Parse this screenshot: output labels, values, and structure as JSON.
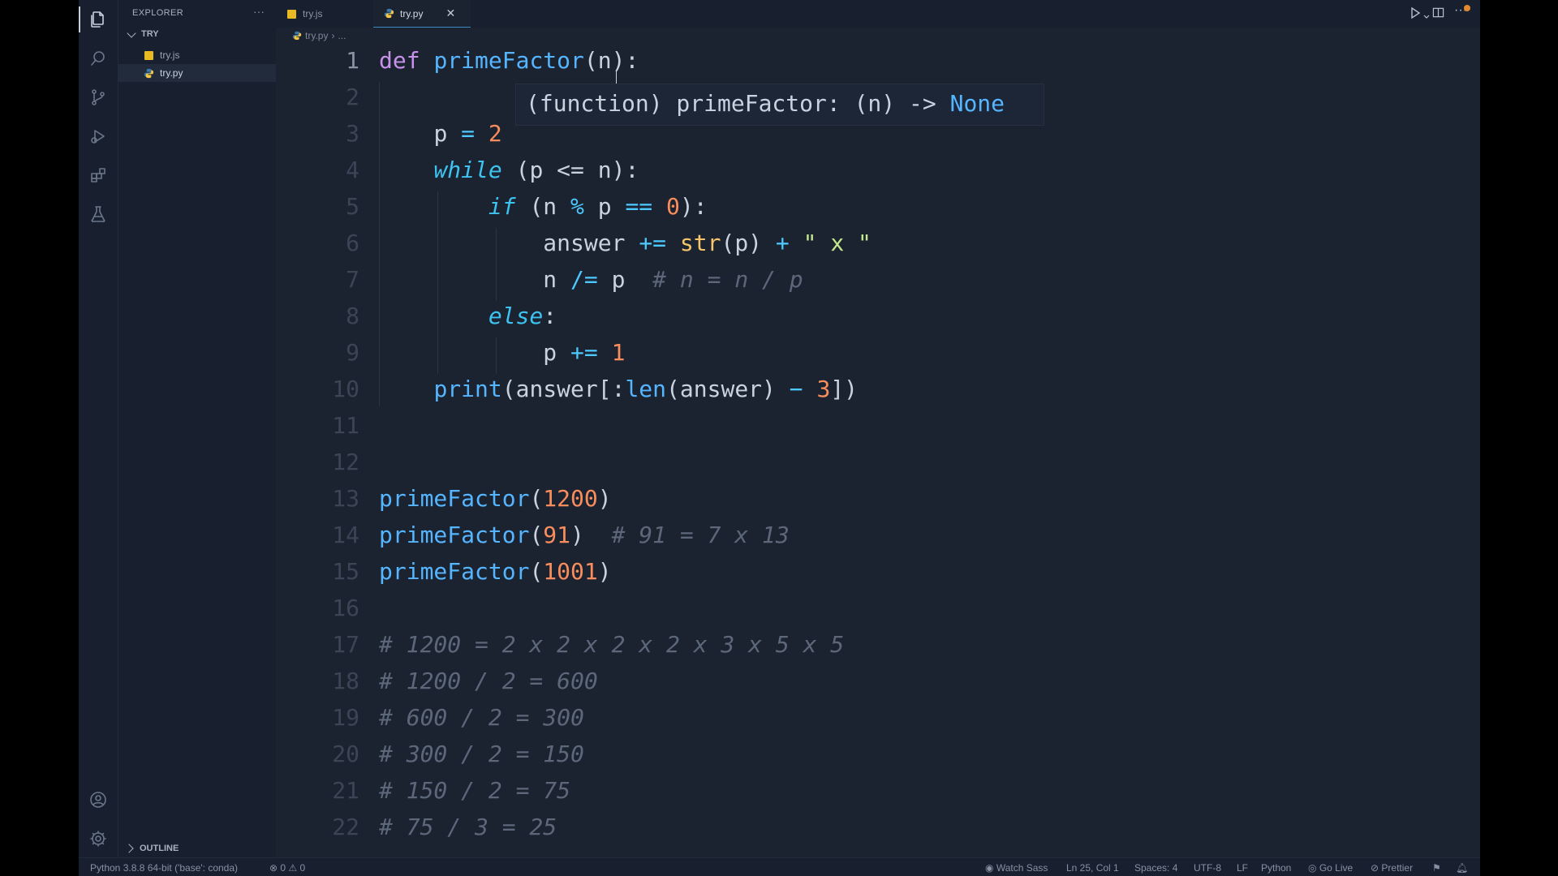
{
  "sidebar": {
    "title": "EXPLORER",
    "more": "···",
    "folder": "TRY",
    "files": [
      {
        "name": "try.js",
        "icon": "js-file-icon"
      },
      {
        "name": "try.py",
        "icon": "python-file-icon"
      }
    ],
    "outline": "OUTLINE"
  },
  "tabs": [
    {
      "label": "try.js",
      "active": false
    },
    {
      "label": "try.py",
      "active": true,
      "close": "✕"
    }
  ],
  "breadcrumb": {
    "file": "try.py",
    "sep": "›",
    "rest": "..."
  },
  "editor": {
    "line_numbers": [
      "1",
      "2",
      "3",
      "4",
      "5",
      "6",
      "7",
      "8",
      "9",
      "10",
      "11",
      "12",
      "13",
      "14",
      "15",
      "16",
      "17",
      "18",
      "19",
      "20",
      "21",
      "22"
    ],
    "current_line": "1",
    "hover": {
      "text": "(function) primeFactor: (n) -> ",
      "type": "None"
    },
    "tokens": {
      "def": "def",
      "fname": "primeFactor",
      "params": "(n):",
      "p": "p",
      "eq": "=",
      "two": "2",
      "while": "while",
      "while_cond": "(p <= n):",
      "if": "if",
      "if_open": "(n ",
      "mod": "%",
      "if_p": " p ",
      "eqeq": "==",
      "zero": "0",
      "if_close": "):",
      "answer": "answer ",
      "pluseq": "+=",
      "str": "str",
      "str_arg": "(p) ",
      "plus": "+",
      "x_str": "\" x \"",
      "n": "n ",
      "diveq": "/=",
      "p_after": " p  ",
      "cm7": "# n = n / p",
      "else": "else",
      "colon": ":",
      "p9": "p ",
      "one": "1",
      "print": "print",
      "print_open": "(answer[:",
      "len": "len",
      "len_arg": "(answer) ",
      "minus": "−",
      "three": "3",
      "print_close": "])",
      "call": "primeFactor",
      "n1200": "1200",
      "n91": "91",
      "n1001": "1001",
      "paren_open": "(",
      "paren_close": ")",
      "cm14": "# 91 = 7 x 13"
    },
    "comments": [
      "# 1200 = 2 x 2 x 2 x 2 x 3 x 5 x 5",
      "# 1200 / 2 = 600",
      "# 600 / 2 = 300",
      "# 300 / 2 = 150",
      "# 150 / 2 = 75",
      "# 75 / 3 = 25"
    ]
  },
  "statusbar": {
    "interpreter": "Python 3.8.8 64-bit ('base': conda)",
    "problems": "⊗ 0 ⚠ 0",
    "watch_sass": "Watch Sass",
    "position": "Ln 25, Col 1",
    "spaces": "Spaces: 4",
    "encoding": "UTF-8",
    "eol": "LF",
    "language": "Python",
    "go_live": "Go Live",
    "prettier": "Prettier"
  },
  "colors": {
    "accent": "#3b8ac4",
    "modified": "#e2892e",
    "background": "#1b2331"
  }
}
